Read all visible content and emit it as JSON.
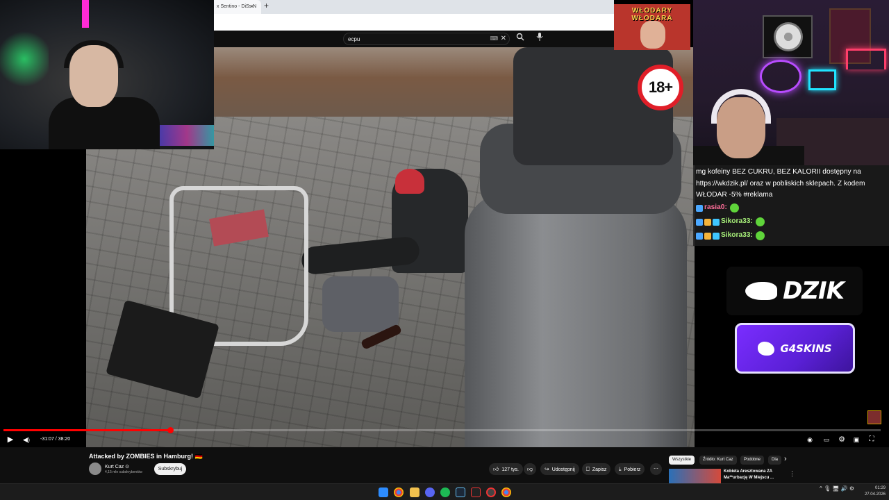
{
  "browser": {
    "tab_title": "x Sentino - DiSs N",
    "tab_close": "×",
    "new_tab": "+"
  },
  "youtube": {
    "search_value": "ecpu",
    "search_kbd": "⌨",
    "search_clear": "✕",
    "search_icon": "search-icon",
    "mic_icon": "mic-icon"
  },
  "overlay": {
    "wlodary_text": "WŁODARY WŁODARA",
    "age_rating": "18+",
    "dzik_logo": "DZIK",
    "g4skins_logo": "G4SKINS"
  },
  "chat": {
    "ad_text": "mg kofeiny BEZ CUKRU, BEZ KALORII dostępny na https://wkdzik.pl/ oraz w pobliskich sklepach. Z kodem WŁODAR -5% #reklama",
    "messages": [
      {
        "user": "rasia0:",
        "badges": [
          "pen"
        ]
      },
      {
        "user": "Sikora33:",
        "badges": [
          "pen",
          "arm",
          "gem"
        ]
      },
      {
        "user": "Sikora33:",
        "badges": [
          "pen",
          "arm",
          "gem"
        ]
      }
    ]
  },
  "player": {
    "time": "-31:07 / 38:20",
    "progress_fraction": 0.19,
    "play_icon": "▶",
    "volume_icon": "◀)"
  },
  "video": {
    "title": "Attacked by ZOMBIES in Hamburg! 🇩🇪",
    "channel": "Kurt Caz ⊙",
    "subscribers": "4,15 mln subskrybentów",
    "subscribe": "Subskrybuj",
    "likes": "127 tys.",
    "share": "Udostępnij",
    "save": "Zapisz",
    "download": "Pobierz",
    "more": "⋯"
  },
  "recommendations": {
    "chips": [
      "Wszystkie",
      "Źródło: Kurt Caz",
      "Podobne",
      "Dla"
    ],
    "active_chip": 0,
    "next_arrow": "›",
    "item_title": "Kobieta Aresztowana ZA Ma**urbację W Miejscu ...",
    "item_more": "⋮"
  },
  "taskbar": {
    "time": "01:29",
    "date": "27.04.2026",
    "tray": "^ 🎙 🖥 🔊 ⚙"
  },
  "colors": {
    "progress": "#ff0000",
    "yt_bg": "#0f0f0f",
    "age_badge_ring": "#e01e28",
    "g4skins": "#7a2dff"
  }
}
